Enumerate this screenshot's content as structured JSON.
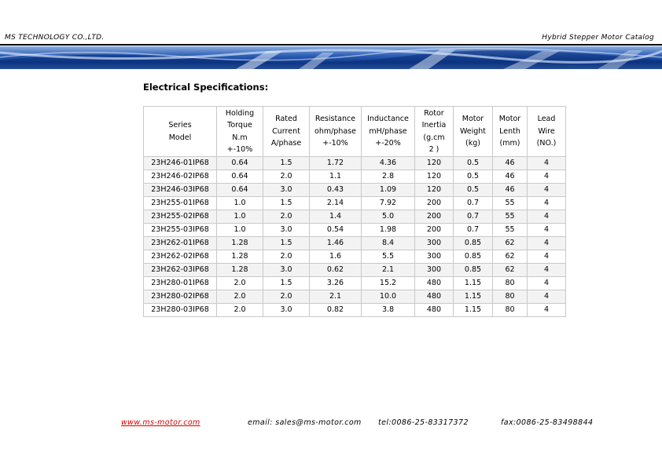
{
  "header": {
    "company": "MS TECHNOLOGY CO.,LTD.",
    "catalog": "Hybrid Stepper Motor Catalog"
  },
  "section_title": "Electrical Specifications:",
  "table": {
    "headers": [
      [
        "Series",
        "Model"
      ],
      [
        "Holding",
        "Torque",
        "N.m",
        "+-10%"
      ],
      [
        "Rated",
        "Current",
        "A/phase"
      ],
      [
        "Resistance",
        "ohm/phase",
        "+-10%"
      ],
      [
        "Inductance",
        "mH/phase",
        "+-20%"
      ],
      [
        "Rotor",
        "Inertia",
        "(g.cm",
        "2 )"
      ],
      [
        "Motor",
        "Weight",
        "(kg)"
      ],
      [
        "Motor",
        "Lenth",
        "(mm)"
      ],
      [
        "Lead",
        "Wire",
        "(NO.)"
      ]
    ],
    "rows": [
      [
        "23H246-01IP68",
        "0.64",
        "1.5",
        "1.72",
        "4.36",
        "120",
        "0.5",
        "46",
        "4"
      ],
      [
        "23H246-02IP68",
        "0.64",
        "2.0",
        "1.1",
        "2.8",
        "120",
        "0.5",
        "46",
        "4"
      ],
      [
        "23H246-03IP68",
        "0.64",
        "3.0",
        "0.43",
        "1.09",
        "120",
        "0.5",
        "46",
        "4"
      ],
      [
        "23H255-01IP68",
        "1.0",
        "1.5",
        "2.14",
        "7.92",
        "200",
        "0.7",
        "55",
        "4"
      ],
      [
        "23H255-02IP68",
        "1.0",
        "2.0",
        "1.4",
        "5.0",
        "200",
        "0.7",
        "55",
        "4"
      ],
      [
        "23H255-03IP68",
        "1.0",
        "3.0",
        "0.54",
        "1.98",
        "200",
        "0.7",
        "55",
        "4"
      ],
      [
        "23H262-01IP68",
        "1.28",
        "1.5",
        "1.46",
        "8.4",
        "300",
        "0.85",
        "62",
        "4"
      ],
      [
        "23H262-02IP68",
        "1.28",
        "2.0",
        "1.6",
        "5.5",
        "300",
        "0.85",
        "62",
        "4"
      ],
      [
        "23H262-03IP68",
        "1.28",
        "3.0",
        "0.62",
        "2.1",
        "300",
        "0.85",
        "62",
        "4"
      ],
      [
        "23H280-01IP68",
        "2.0",
        "1.5",
        "3.26",
        "15.2",
        "480",
        "1.15",
        "80",
        "4"
      ],
      [
        "23H280-02IP68",
        "2.0",
        "2.0",
        "2.1",
        "10.0",
        "480",
        "1.15",
        "80",
        "4"
      ],
      [
        "23H280-03IP68",
        "2.0",
        "3.0",
        "0.82",
        "3.8",
        "480",
        "1.15",
        "80",
        "4"
      ]
    ]
  },
  "footer": {
    "website": "www.ms-motor.com",
    "email": "email: sales@ms-motor.com",
    "tel": "tel:0086-25-83317372",
    "fax": "fax:0086-25-83498844"
  },
  "colors": {
    "link": "#d40000",
    "banner_dark": "#0d3a8c",
    "banner_light": "#8fb0de"
  }
}
